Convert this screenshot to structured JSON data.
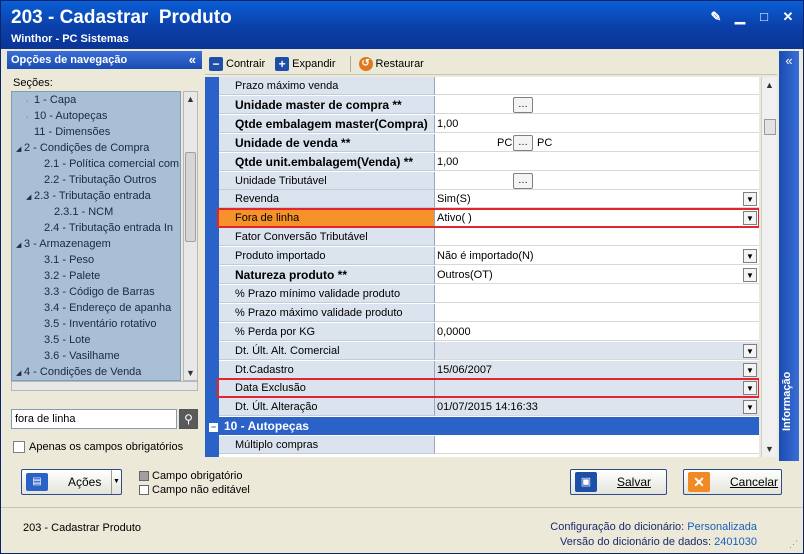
{
  "window": {
    "title": "203 - Cadastrar  Produto",
    "subtitle": "Winthor - PC Sistemas",
    "controls": {
      "edit": "✎",
      "minimize": "▁",
      "maximize": "□",
      "close": "✕"
    }
  },
  "nav": {
    "header": "Opções de navegação",
    "collapse_glyph": "«",
    "sections_label": "Seções:",
    "tree": [
      {
        "label": "1 - Capa",
        "indent": 1,
        "prefix": "·"
      },
      {
        "label": "10 - Autopeças",
        "indent": 1,
        "prefix": "·"
      },
      {
        "label": "11 - Dimensões",
        "indent": 1,
        "prefix": ""
      },
      {
        "label": "2 - Condições de Compra",
        "indent": 0,
        "prefix": "◢"
      },
      {
        "label": "2.1 - Política comercial com",
        "indent": 2,
        "prefix": ""
      },
      {
        "label": "2.2 - Tributação Outros",
        "indent": 2,
        "prefix": ""
      },
      {
        "label": "2.3 - Tributação entrada",
        "indent": 1,
        "prefix": "◢"
      },
      {
        "label": "2.3.1 - NCM",
        "indent": 3,
        "prefix": ""
      },
      {
        "label": "2.4 - Tributação entrada In",
        "indent": 2,
        "prefix": ""
      },
      {
        "label": "3 - Armazenagem",
        "indent": 0,
        "prefix": "◢"
      },
      {
        "label": "3.1 - Peso",
        "indent": 2,
        "prefix": ""
      },
      {
        "label": "3.2 - Palete",
        "indent": 2,
        "prefix": ""
      },
      {
        "label": "3.3 - Código de Barras",
        "indent": 2,
        "prefix": ""
      },
      {
        "label": "3.4 - Endereço de apanha",
        "indent": 2,
        "prefix": ""
      },
      {
        "label": "3.5 - Inventário rotativo",
        "indent": 2,
        "prefix": ""
      },
      {
        "label": "3.5 - Lote",
        "indent": 2,
        "prefix": ""
      },
      {
        "label": "3.6 - Vasilhame",
        "indent": 2,
        "prefix": ""
      },
      {
        "label": "4 - Condições de Venda",
        "indent": 0,
        "prefix": "◢"
      }
    ],
    "search_value": "fora de linha",
    "search_icon": "magnifier-icon",
    "only_required_label": "Apenas os campos obrigatórios"
  },
  "toolbar": {
    "contract_label": "Contrair",
    "expand_label": "Expandir",
    "restore_label": "Restaurar"
  },
  "grid": {
    "rows": [
      {
        "label": "Prazo máximo venda",
        "value": "",
        "bold": false
      },
      {
        "label": "Unidade master de compra **",
        "value": "",
        "bold": true,
        "ellipsis": true
      },
      {
        "label": "Qtde embalagem master(Compra)",
        "value": "1,00",
        "bold": true
      },
      {
        "label": "Unidade de venda **",
        "value": "PC",
        "value2": "PC",
        "bold": true,
        "ellipsis": true
      },
      {
        "label": "Qtde unit.embalagem(Venda) **",
        "value": "1,00",
        "bold": true
      },
      {
        "label": "Unidade Tributável",
        "value": "",
        "bold": false,
        "ellipsis": true
      },
      {
        "label": "Revenda",
        "value": "Sim(S)",
        "bold": false,
        "dropdown": true
      },
      {
        "label": "Fora de linha",
        "value": "Ativo(  )",
        "bold": false,
        "dropdown": true,
        "highlight": true
      },
      {
        "label": "Fator Conversão Tributável",
        "value": "",
        "bold": false
      },
      {
        "label": "Produto importado",
        "value": "Não é importado(N)",
        "bold": false,
        "dropdown": true
      },
      {
        "label": "Natureza produto **",
        "value": "Outros(OT)",
        "bold": true,
        "dropdown": true
      },
      {
        "label": "% Prazo mínimo validade produto",
        "value": "",
        "bold": false
      },
      {
        "label": "% Prazo máximo validade produto",
        "value": "",
        "bold": false
      },
      {
        "label": "% Perda por KG",
        "value": "0,0000",
        "bold": false
      },
      {
        "label": "Dt. Últ. Alt. Comercial",
        "value": "",
        "bold": false,
        "dropdown": true,
        "shade": true
      },
      {
        "label": "Dt.Cadastro",
        "value": "15/06/2007",
        "bold": false,
        "dropdown": true,
        "shade": true
      },
      {
        "label": "Data Exclusão",
        "value": "",
        "bold": false,
        "dropdown": true,
        "shade": true,
        "outlined": true
      },
      {
        "label": "Dt. Últ. Alteração",
        "value": "01/07/2015 14:16:33",
        "bold": false,
        "dropdown": true,
        "shade": true
      }
    ],
    "group": {
      "label": "10 - Autopeças",
      "toggle": "−"
    },
    "after_group_rows": [
      {
        "label": "Múltiplo compras",
        "value": "",
        "bold": false
      }
    ]
  },
  "info_tab": {
    "label": "Informação",
    "collapse_glyph": "«"
  },
  "actions": {
    "acoes_label": "Ações",
    "legend_required": "Campo obrigatório",
    "legend_not_editable": "Campo não editável",
    "save_label": "Salvar",
    "cancel_label": "Cancelar"
  },
  "status": {
    "left": "203 - Cadastrar  Produto",
    "dict_config_label": "Configuração do dicionário:",
    "dict_config_value": "Personalizada",
    "dict_version_label": "Versão do dicionário de dados:",
    "dict_version_value": "2401030"
  },
  "colors": {
    "title_bar": "#0b3fa8",
    "highlight_label": "#f5922a",
    "highlight_border": "#e0262e",
    "group_bar": "#2a62c8"
  }
}
